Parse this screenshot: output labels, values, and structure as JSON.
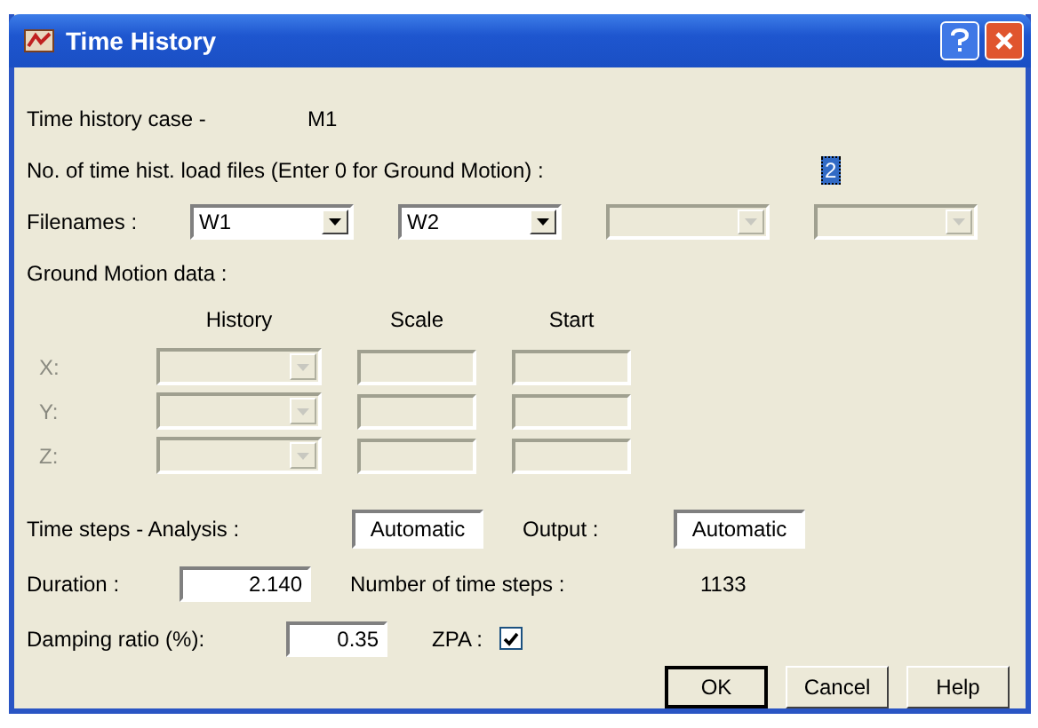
{
  "window": {
    "title": "Time History"
  },
  "case": {
    "label": "Time history case -",
    "value": "M1"
  },
  "load_files": {
    "label": "No. of time hist. load files (Enter 0 for Ground Motion) :",
    "value": "2"
  },
  "filenames": {
    "label": "Filenames :",
    "combos": [
      {
        "value": "W1",
        "disabled": false
      },
      {
        "value": "W2",
        "disabled": false
      },
      {
        "disabled": true
      },
      {
        "disabled": true
      }
    ]
  },
  "ground_motion": {
    "title": "Ground Motion data :",
    "columns": [
      "History",
      "Scale",
      "Start"
    ],
    "rows": [
      {
        "axis": "X:",
        "disabled": true
      },
      {
        "axis": "Y:",
        "disabled": true
      },
      {
        "axis": "Z:",
        "disabled": true
      }
    ]
  },
  "time_steps": {
    "label": "Time steps - Analysis :",
    "analysis": "Automatic",
    "output_label": "Output :",
    "output": "Automatic"
  },
  "duration": {
    "label": "Duration :",
    "value": "2.140",
    "steps_label": "Number of time steps :",
    "steps_value": "1133"
  },
  "damping": {
    "label": "Damping ratio (%):",
    "value": "0.35",
    "zpa_label": "ZPA :",
    "zpa_checked": true
  },
  "buttons": [
    {
      "label": "OK",
      "default": true
    },
    {
      "label": "Cancel",
      "default": false
    },
    {
      "label": "Help",
      "default": false
    }
  ]
}
